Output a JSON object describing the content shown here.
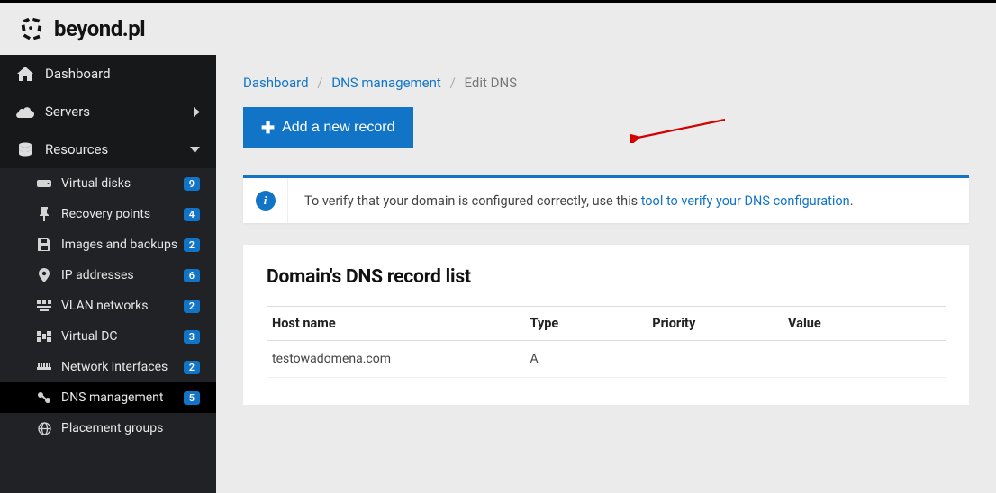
{
  "brand": "beyond.pl",
  "sidebar": {
    "dashboard": "Dashboard",
    "servers": "Servers",
    "resources": "Resources",
    "items": [
      {
        "label": "Virtual disks",
        "badge": "9"
      },
      {
        "label": "Recovery points",
        "badge": "4"
      },
      {
        "label": "Images and backups",
        "badge": "2"
      },
      {
        "label": "IP addresses",
        "badge": "6"
      },
      {
        "label": "VLAN networks",
        "badge": "2"
      },
      {
        "label": "Virtual DC",
        "badge": "3"
      },
      {
        "label": "Network interfaces",
        "badge": "2"
      },
      {
        "label": "DNS management",
        "badge": "5"
      },
      {
        "label": "Placement groups",
        "badge": ""
      }
    ]
  },
  "breadcrumbs": {
    "dashboard": "Dashboard",
    "dns_mgmt": "DNS management",
    "current": "Edit DNS"
  },
  "actions": {
    "add_record": "Add a new record"
  },
  "info": {
    "prefix": "To verify that your domain is configured correctly, use this ",
    "link": "tool to verify your DNS configuration",
    "suffix": "."
  },
  "panel": {
    "title": "Domain's DNS record list",
    "columns": {
      "host": "Host name",
      "type": "Type",
      "priority": "Priority",
      "value": "Value"
    },
    "rows": [
      {
        "host": "testowadomena.com",
        "type": "A",
        "priority": "",
        "value": ""
      }
    ]
  }
}
